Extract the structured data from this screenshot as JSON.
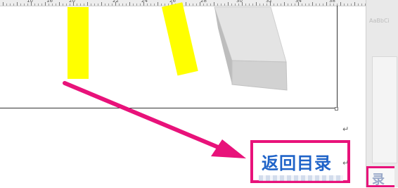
{
  "ruler": {
    "labels": [
      "10",
      "16",
      "18",
      "20",
      "22",
      "24",
      "26",
      "28",
      "30",
      "32",
      "34",
      "36",
      "38"
    ]
  },
  "document": {
    "paragraph_mark": "↵"
  },
  "return_link": {
    "label": "返回目录",
    "mark": "↵"
  },
  "side_pane": {
    "styles_hint": "AaBbCi",
    "badge_text": "录"
  },
  "colors": {
    "highlight": "#ffff00",
    "accent": "#e8127a",
    "link": "#1f63c8"
  }
}
